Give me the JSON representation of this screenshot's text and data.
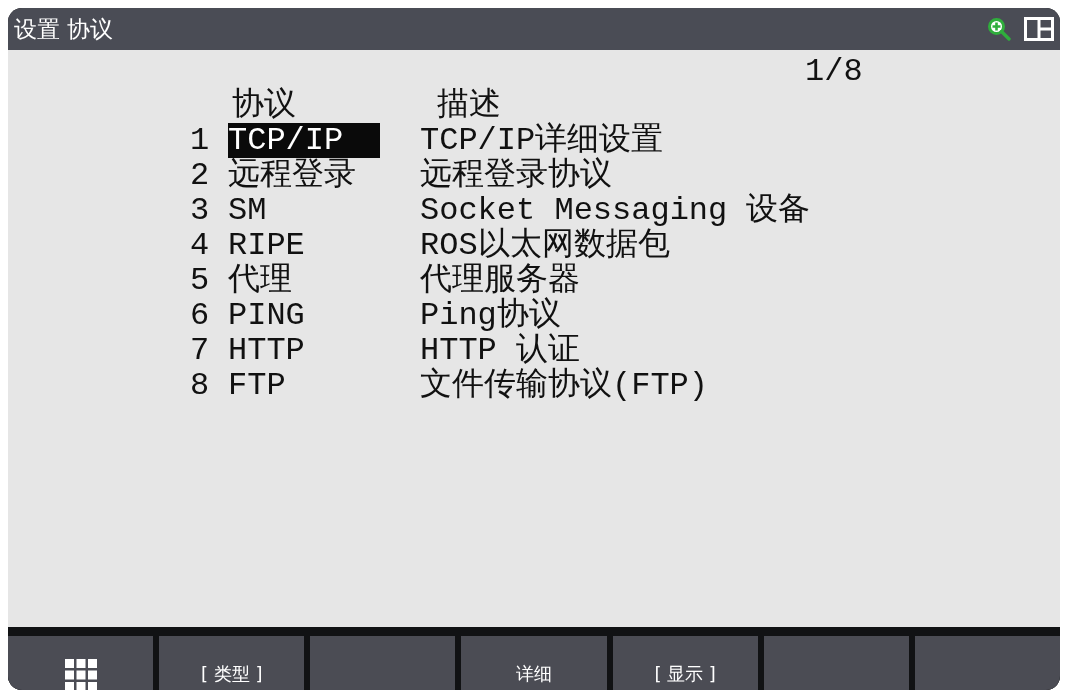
{
  "title_bar": {
    "title": "设置 协议"
  },
  "page_indicator": "1/8",
  "table": {
    "columns": [
      "协议",
      "描述"
    ],
    "rows": [
      {
        "number": "1",
        "protocol": "TCP/IP",
        "description": "TCP/IP详细设置",
        "selected": true
      },
      {
        "number": "2",
        "protocol": "远程登录",
        "description": "远程登录协议",
        "selected": false
      },
      {
        "number": "3",
        "protocol": "SM",
        "description": "Socket Messaging 设备",
        "selected": false
      },
      {
        "number": "4",
        "protocol": "RIPE",
        "description": "ROS以太网数据包",
        "selected": false
      },
      {
        "number": "5",
        "protocol": "代理",
        "description": "代理服务器",
        "selected": false
      },
      {
        "number": "6",
        "protocol": "PING",
        "description": "Ping协议",
        "selected": false
      },
      {
        "number": "7",
        "protocol": "HTTP",
        "description": "HTTP 认证",
        "selected": false
      },
      {
        "number": "8",
        "protocol": "FTP",
        "description": "文件传输协议(FTP)",
        "selected": false
      }
    ]
  },
  "softkeys": [
    {
      "kind": "menu"
    },
    {
      "kind": "label",
      "label": "[ 类型 ]"
    },
    {
      "kind": "blank"
    },
    {
      "kind": "label",
      "label": "详细"
    },
    {
      "kind": "label",
      "label": "[ 显示 ]"
    },
    {
      "kind": "blank"
    },
    {
      "kind": "blank"
    }
  ]
}
